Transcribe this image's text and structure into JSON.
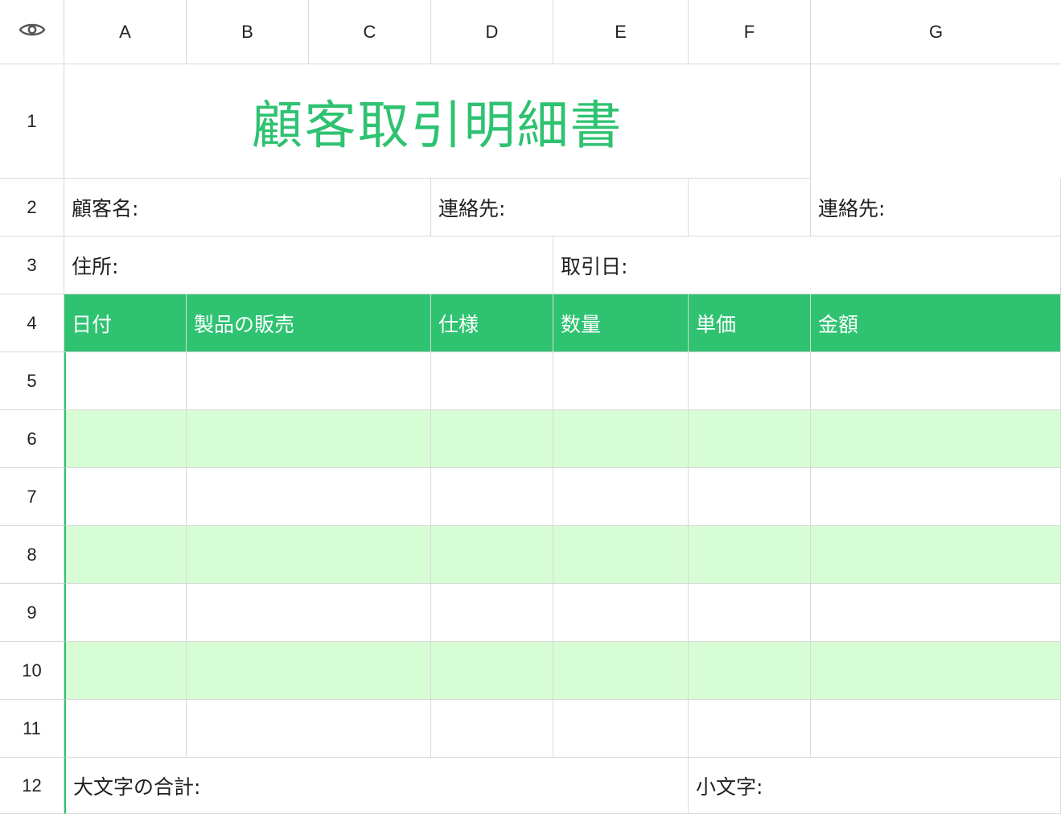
{
  "columns": [
    "A",
    "B",
    "C",
    "D",
    "E",
    "F",
    "G"
  ],
  "rows": [
    "1",
    "2",
    "3",
    "4",
    "5",
    "6",
    "7",
    "8",
    "9",
    "10",
    "11",
    "12"
  ],
  "title": "顧客取引明細書",
  "row2": {
    "customer_name": "顧客名:",
    "contact_1": "連絡先:",
    "contact_2": "連絡先:"
  },
  "row3": {
    "address": "住所:",
    "transaction_date": "取引日:"
  },
  "table_headers": [
    "日付",
    "製品の販売",
    "仕様",
    "数量",
    "単価",
    "金額"
  ],
  "row12": {
    "total_uppercase": "大文字の合計:",
    "lowercase": "小文字:"
  },
  "colors": {
    "accent": "#2ec271",
    "stripe": "#d7fdd5",
    "grid": "#d9d9d9"
  },
  "icons": {
    "corner": "eye-icon"
  }
}
